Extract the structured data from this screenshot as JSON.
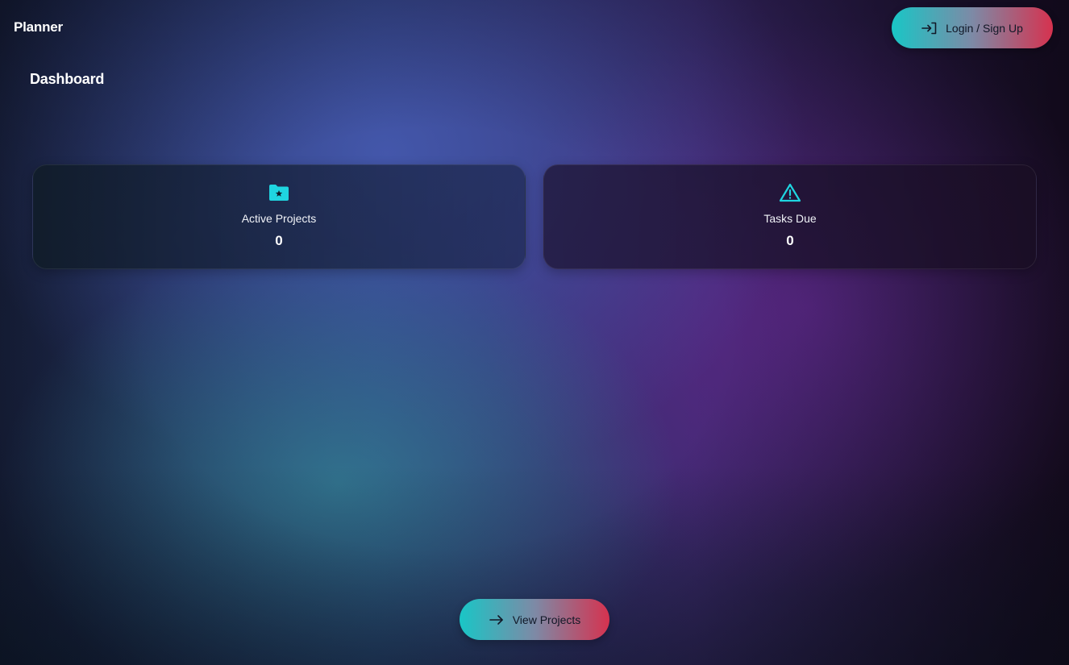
{
  "header": {
    "app_title": "Planner",
    "login_label": "Login / Sign Up",
    "login_icon": "login-icon"
  },
  "page": {
    "title": "Dashboard"
  },
  "stats": [
    {
      "label": "Active Projects",
      "value": "0",
      "icon": "folder-star-icon"
    },
    {
      "label": "Tasks Due",
      "value": "0",
      "icon": "warning-icon"
    }
  ],
  "footer": {
    "view_projects_label": "View Projects",
    "view_projects_icon": "arrow-right-icon"
  },
  "colors": {
    "accent": "#19c6c6",
    "gradient_start": "#19c6c6",
    "gradient_end": "#d6324f"
  }
}
